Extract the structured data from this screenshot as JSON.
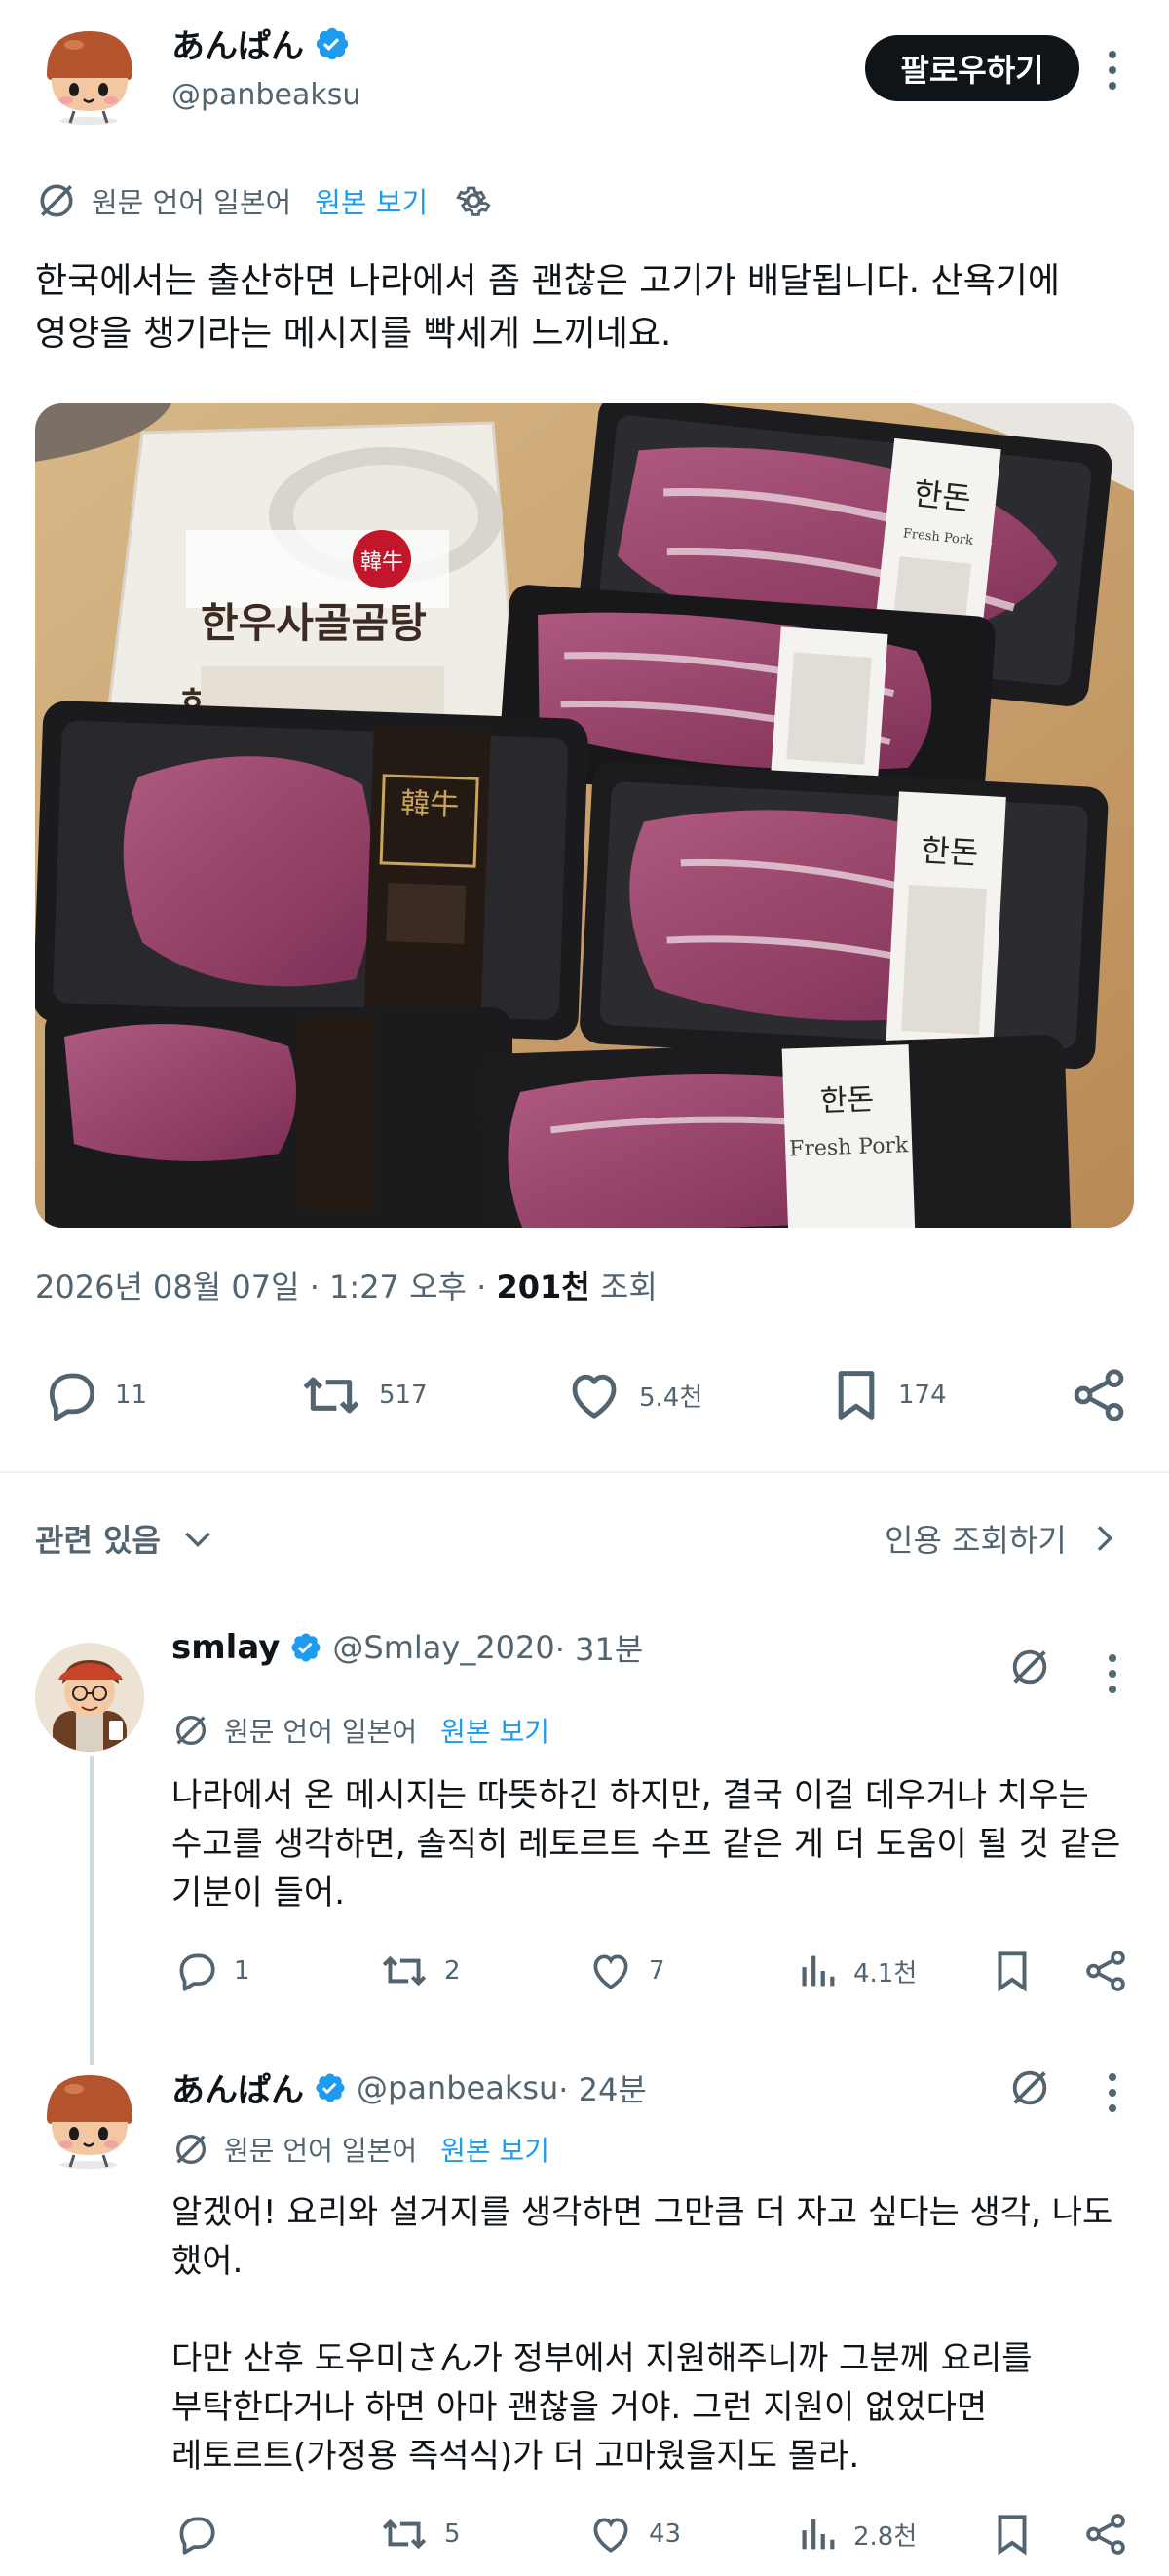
{
  "post": {
    "display_name": "あんぱん",
    "handle": "@panbeaksu",
    "follow_label": "팔로우하기",
    "translation_label": "원문 언어 일본어",
    "show_original": "원본 보기",
    "text_line1": "한국에서는 출산하면 나라에서 좀 괜찮은 고기가 배달됩니다. 산욕기에",
    "text_line2": "영양을 챙기라는 메시지를 빡세게 느끼네요.",
    "photo_labels": {
      "soup_badge": "韓牛",
      "soup_title": "한우사골곰탕",
      "soup_partial": "한",
      "beef_band": "韓牛",
      "brand1": "한돈",
      "brand_en": "Fresh Pork",
      "brand2": "한돈",
      "brand3": "한돈",
      "brand_en3": "Fresh Pork"
    },
    "meta_date": "2026년 08월 07일 · 1:27 오후 · ",
    "meta_views_num": "201천",
    "meta_views_label": " 조회",
    "counts": {
      "replies": "11",
      "reposts": "517",
      "likes": "5.4천",
      "bookmarks": "174"
    }
  },
  "related": {
    "label": "관련 있음",
    "quotes_link": "인용 조회하기"
  },
  "replies": [
    {
      "display_name": "smlay",
      "handle": "@Smlay_2020",
      "time": " · 31분",
      "translation_label": "원문 언어 일본어",
      "show_original": "원본 보기",
      "lines": [
        "나라에서 온 메시지는 따뜻하긴 하지만, 결국 이걸 데우거나 치우는",
        "수고를 생각하면, 솔직히 레토르트 수프 같은 게 더 도움이 될 것 같은",
        "기분이 들어."
      ],
      "counts": {
        "replies": "1",
        "reposts": "2",
        "likes": "7",
        "views": "4.1천"
      }
    },
    {
      "display_name": "あんぱん",
      "handle": "@panbeaksu",
      "time": " · 24분",
      "translation_label": "원문 언어 일본어",
      "show_original": "원본 보기",
      "lines": [
        "알겠어! 요리와 설거지를 생각하면 그만큼 더 자고 싶다는 생각, 나도",
        "했어.",
        "",
        "다만 산후 도우미さん가 정부에서 지원해주니까 그분께 요리를",
        "부탁한다거나 하면 아마 괜찮을 거야. 그런 지원이 없었다면",
        "레토르트(가정용 즉석식)가 더 고마웠을지도 몰라."
      ],
      "counts": {
        "replies": "",
        "reposts": "5",
        "likes": "43",
        "views": "2.8천"
      }
    }
  ],
  "colors": {
    "accent": "#1d9bf0",
    "text": "#0f1419",
    "muted": "#536471",
    "divider": "#eff3f4"
  }
}
